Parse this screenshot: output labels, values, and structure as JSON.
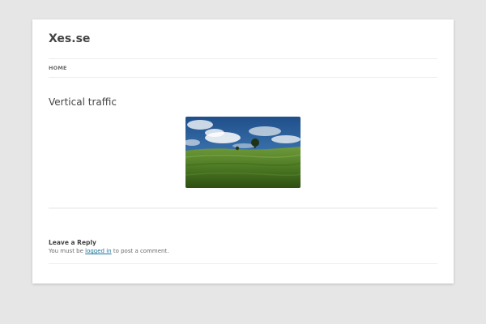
{
  "site": {
    "title": "Xes.se"
  },
  "nav": {
    "items": [
      {
        "label": "HOME"
      }
    ]
  },
  "entry": {
    "title": "Vertical traffic",
    "image_subject": "landscape-photo"
  },
  "comments": {
    "reply_title": "Leave a Reply",
    "note_prefix": "You must be ",
    "login_link": "logged in",
    "note_suffix": " to post a comment."
  },
  "colors": {
    "background": "#e6e6e6",
    "page": "#ffffff",
    "text": "#444444",
    "link": "#21759b"
  }
}
